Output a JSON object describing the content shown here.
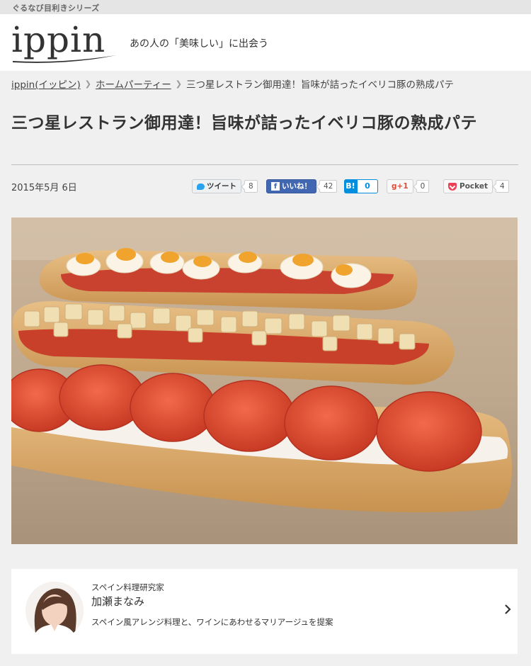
{
  "top_bar": {
    "series_label": "ぐるなび目利きシリーズ"
  },
  "header": {
    "logo_text": "ippin",
    "tagline": "あの人の「美味しい」に出会う"
  },
  "breadcrumb": [
    {
      "label": "ippin(イッピン)"
    },
    {
      "label": "ホームパーティー"
    },
    {
      "label": "三つ星レストラン御用達！旨味が詰ったイベリコ豚の熟成パテ"
    }
  ],
  "article": {
    "title": "三つ星レストラン御用達！旨味が詰ったイベリコ豚の熟成パテ",
    "date": "2015年5月 6日"
  },
  "social": {
    "tweet": {
      "label": "ツイート",
      "count": "8"
    },
    "facebook": {
      "label": "いいね！",
      "count": "42"
    },
    "hatena": {
      "label": "B!",
      "count": "0"
    },
    "gplus": {
      "label": "g+1",
      "count": "0"
    },
    "pocket": {
      "label": "Pocket",
      "count": "4"
    }
  },
  "author": {
    "role": "スペイン料理研究家",
    "name": "加瀬まなみ",
    "description": "スペイン風アレンジ料理と、ワインにあわせるマリアージュを提案"
  },
  "colors": {
    "facebook": "#4267b2",
    "hatena": "#008fde",
    "gplus": "#dd4b39",
    "pocket": "#ee4056",
    "twitter": "#2aa3ef"
  }
}
